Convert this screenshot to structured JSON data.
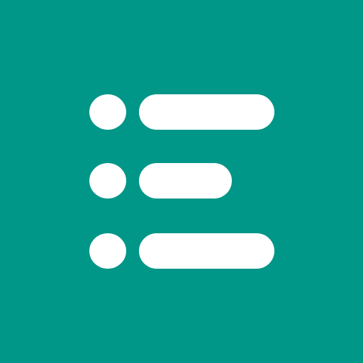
{
  "icon": {
    "name": "list-icon",
    "background_color": "#009688",
    "foreground_color": "#ffffff",
    "rows": [
      {
        "name": "list-row-1"
      },
      {
        "name": "list-row-2"
      },
      {
        "name": "list-row-3"
      }
    ]
  }
}
